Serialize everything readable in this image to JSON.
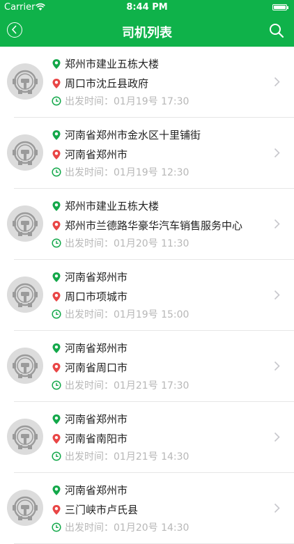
{
  "status_bar": {
    "carrier": "Carrier",
    "time": "8:44 PM"
  },
  "nav": {
    "title": "司机列表",
    "back_icon": "back-circle-icon",
    "search_icon": "search-icon"
  },
  "colors": {
    "brand_green": "#0fb24a",
    "from_pin": "#13a84a",
    "to_pin": "#e94646",
    "time_gray": "#b7b7b7"
  },
  "trips": [
    {
      "from": "郑州市建业五栋大楼",
      "to": "周口市沈丘县政府",
      "time_label": "出发时间：",
      "time": "01月19号 17:30"
    },
    {
      "from": "河南省郑州市金水区十里铺街",
      "to": "河南省郑州市",
      "time_label": "出发时间：",
      "time": "01月19号 12:30"
    },
    {
      "from": "郑州市建业五栋大楼",
      "to": "郑州市兰德路华豪华汽车销售服务中心",
      "time_label": "出发时间：",
      "time": "01月20号 11:30"
    },
    {
      "from": "河南省郑州市",
      "to": "周口市项城市",
      "time_label": "出发时间：",
      "time": "01月19号 15:00"
    },
    {
      "from": "河南省郑州市",
      "to": "河南省周口市",
      "time_label": "出发时间：",
      "time": "01月21号 17:30"
    },
    {
      "from": "河南省郑州市",
      "to": "河南省南阳市",
      "time_label": "出发时间：",
      "time": "01月21号 14:30"
    },
    {
      "from": "河南省郑州市",
      "to": "三门峡市卢氏县",
      "time_label": "出发时间：",
      "time": "01月20号 14:30"
    }
  ]
}
